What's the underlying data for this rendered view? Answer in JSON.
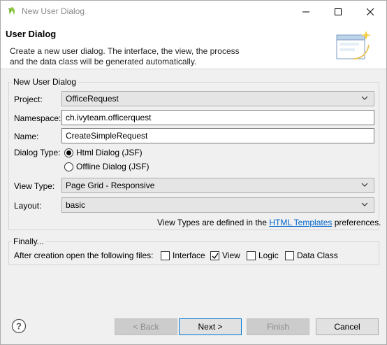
{
  "window": {
    "title": "New User Dialog"
  },
  "banner": {
    "title": "User Dialog",
    "description_line1": "Create a new user dialog. The interface, the view, the process",
    "description_line2": "and the data class will be generated automatically."
  },
  "main_group": {
    "title": "New User Dialog",
    "project": {
      "label": "Project:",
      "value": "OfficeRequest"
    },
    "namespace": {
      "label": "Namespace:",
      "value": "ch.ivyteam.officerquest"
    },
    "name": {
      "label": "Name:",
      "value": "CreateSimpleRequest"
    },
    "dialog_type": {
      "label": "Dialog Type:",
      "options": [
        {
          "label": "Html Dialog (JSF)",
          "selected": true
        },
        {
          "label": "Offline Dialog (JSF)",
          "selected": false
        }
      ]
    },
    "view_type": {
      "label": "View Type:",
      "value": "Page Grid - Responsive"
    },
    "layout": {
      "label": "Layout:",
      "value": "basic"
    },
    "info": {
      "prefix": "View Types are defined in the ",
      "link": "HTML Templates",
      "suffix": " preferences."
    }
  },
  "finally_group": {
    "title": "Finally...",
    "label": "After creation open the following files:",
    "checkboxes": [
      {
        "label": "Interface",
        "checked": false
      },
      {
        "label": "View",
        "checked": true
      },
      {
        "label": "Logic",
        "checked": false
      },
      {
        "label": "Data Class",
        "checked": false
      }
    ]
  },
  "buttons": {
    "back": "< Back",
    "next": "Next >",
    "finish": "Finish",
    "cancel": "Cancel"
  },
  "icons": {
    "app": "ivy-leaf-icon",
    "banner": "dialog-wizard-icon",
    "help": "help-icon"
  },
  "colors": {
    "link": "#0066cc",
    "accent": "#0078d7"
  }
}
